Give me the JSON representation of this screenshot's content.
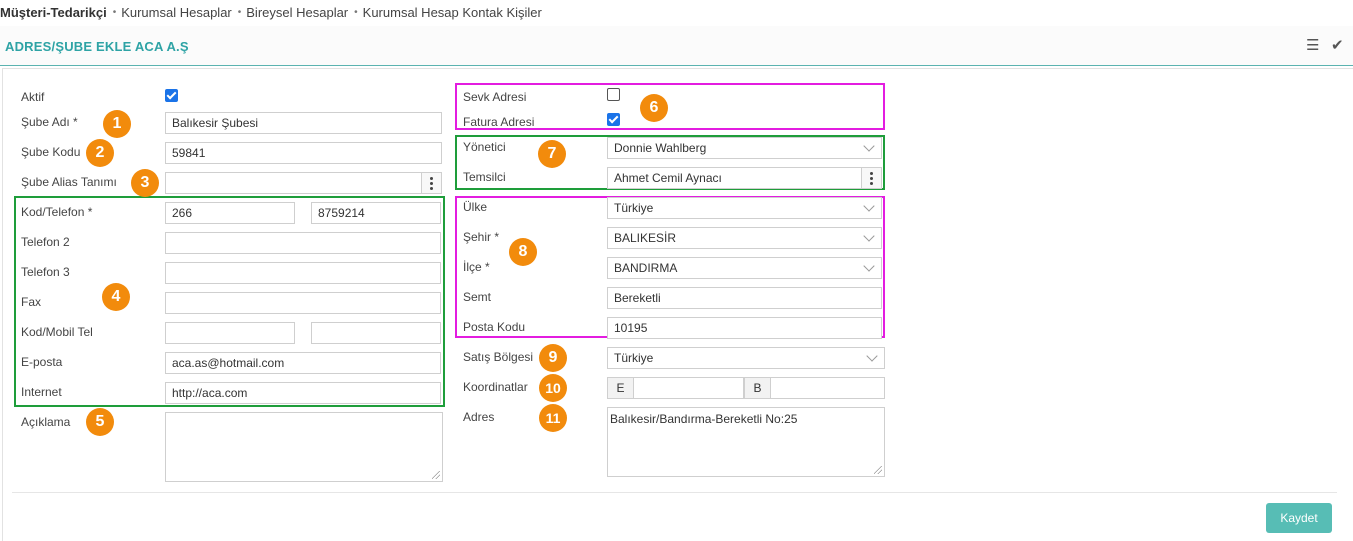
{
  "breadcrumb": {
    "root": "Müşteri-Tedarikçi",
    "items": [
      "Kurumsal Hesaplar",
      "Bireysel Hesaplar",
      "Kurumsal Hesap Kontak Kişiler"
    ]
  },
  "header": {
    "title": "ADRES/ŞUBE EKLE ACA A.Ş",
    "list_icon": "☰",
    "check_icon": "✔"
  },
  "left": {
    "aktif_label": "Aktif",
    "sube_adi_label": "Şube Adı *",
    "sube_adi_value": "Balıkesir Şubesi",
    "sube_kodu_label": "Şube Kodu",
    "sube_kodu_value": "59841",
    "alias_label": "Şube Alias Tanımı",
    "alias_value": "",
    "kod_telefon_label": "Kod/Telefon *",
    "kod_telefon_code": "266",
    "kod_telefon_number": "8759214",
    "telefon2_label": "Telefon 2",
    "telefon2_value": "",
    "telefon3_label": "Telefon 3",
    "telefon3_value": "",
    "fax_label": "Fax",
    "fax_value": "",
    "mobil_label": "Kod/Mobil Tel",
    "mobil_code": "",
    "mobil_number": "",
    "eposta_label": "E-posta",
    "eposta_value": "aca.as@hotmail.com",
    "internet_label": "Internet",
    "internet_value": "http://aca.com",
    "aciklama_label": "Açıklama",
    "aciklama_value": ""
  },
  "right": {
    "sevk_label": "Sevk Adresi",
    "fatura_label": "Fatura Adresi",
    "yonetici_label": "Yönetici",
    "yonetici_value": "Donnie Wahlberg",
    "temsilci_label": "Temsilci",
    "temsilci_value": "Ahmet Cemil Aynacı",
    "ulke_label": "Ülke",
    "ulke_value": "Türkiye",
    "sehir_label": "Şehir *",
    "sehir_value": "BALIKESİR",
    "ilce_label": "İlçe *",
    "ilce_value": "BANDIRMA",
    "semt_label": "Semt",
    "semt_value": "Bereketli",
    "posta_label": "Posta Kodu",
    "posta_value": "10195",
    "satis_label": "Satış Bölgesi",
    "satis_value": "Türkiye",
    "koordinat_label": "Koordinatlar",
    "koordinat_e": "E",
    "koordinat_b": "B",
    "adres_label": "Adres",
    "adres_value": "Balıkesir/Bandırma-Bereketli No:25"
  },
  "badges": [
    "1",
    "2",
    "3",
    "4",
    "5",
    "6",
    "7",
    "8",
    "9",
    "10",
    "11"
  ],
  "actions": {
    "save_label": "Kaydet"
  },
  "checkboxes": {
    "aktif": true,
    "sevk": false,
    "fatura": true
  },
  "colors": {
    "accent": "#2ea3a5",
    "badge": "#f28b0c",
    "green_box": "#1e9d3a",
    "pink_box": "#e31ce0",
    "save_button": "#57bdb5"
  }
}
